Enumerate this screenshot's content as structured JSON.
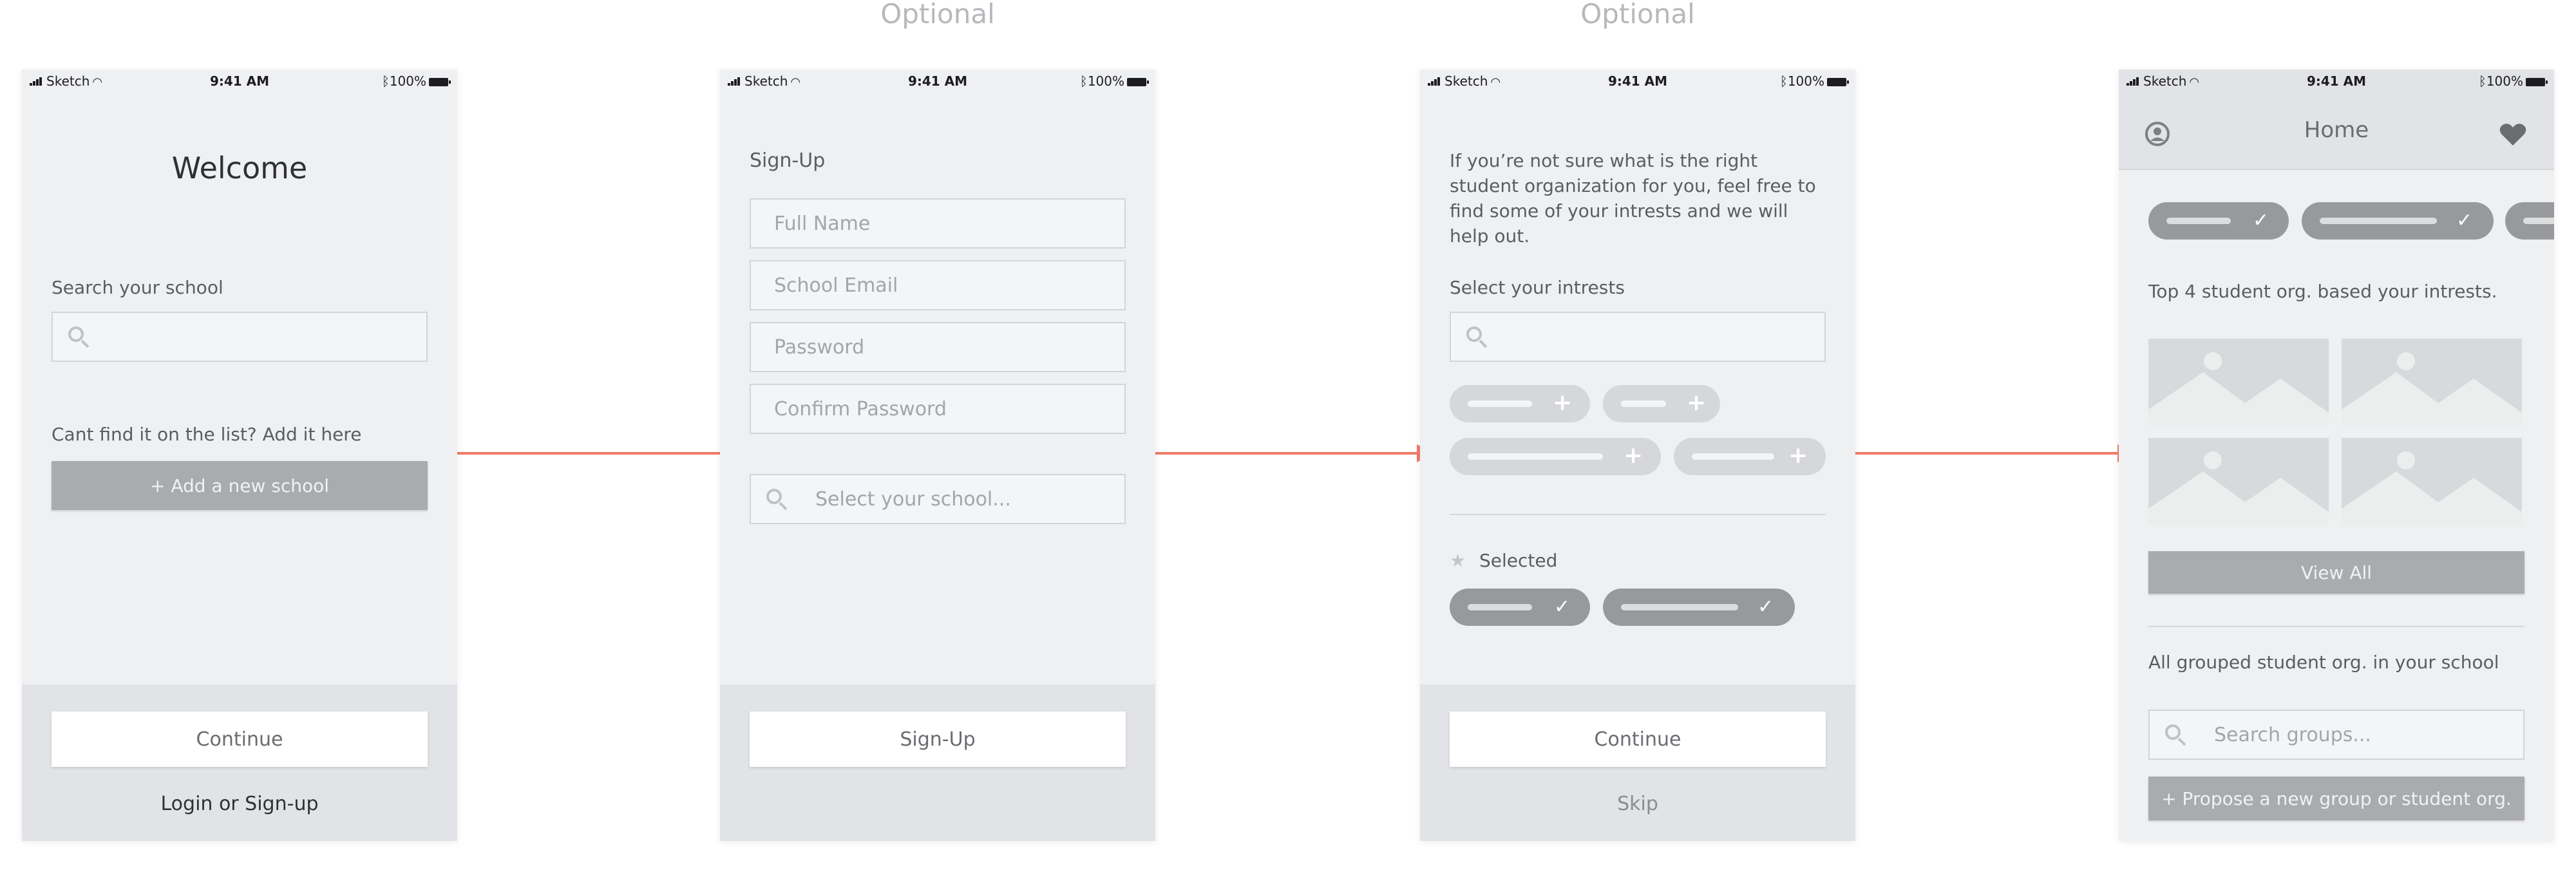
{
  "optional_labels": [
    "Optional",
    "Optional"
  ],
  "status_bar": {
    "carrier": "Sketch",
    "time": "9:41 AM",
    "battery": "100%"
  },
  "screen1": {
    "title": "Welcome",
    "search_label": "Search your school",
    "search_placeholder": "",
    "cant_find": "Cant find it on the list? Add it here",
    "add_school": "+ Add a new school",
    "continue": "Continue",
    "login": "Login or Sign-up"
  },
  "screen2": {
    "title": "Sign-Up",
    "fields": [
      "Full Name",
      "School Email",
      "Password",
      "Confirm Password"
    ],
    "school_placeholder": "Select your school...",
    "signup_button": "Sign-Up"
  },
  "screen3": {
    "intro": "If you’re not sure what is the right student organization for you, feel free to find some of your intrests and we will help out.",
    "select_label": "Select your intrests",
    "selected_label": "Selected",
    "continue": "Continue",
    "skip": "Skip"
  },
  "screen4": {
    "nav_title": "Home",
    "top_label": "Top 4 student org. based your intrests.",
    "view_all": "View All",
    "grouped_label": "All grouped student org. in your school",
    "search_groups": "Search groups...",
    "propose": "+ Propose a new group or student org."
  },
  "colors": {
    "arrow": "#f07b68",
    "screen_bg": "#eff0f2",
    "footer_bg": "#e2e3e6",
    "gray_button": "#a9abaf"
  },
  "icons": [
    "search-icon",
    "user-icon",
    "heart-icon",
    "star-icon",
    "check-icon",
    "plus-icon",
    "image-placeholder-icon"
  ]
}
